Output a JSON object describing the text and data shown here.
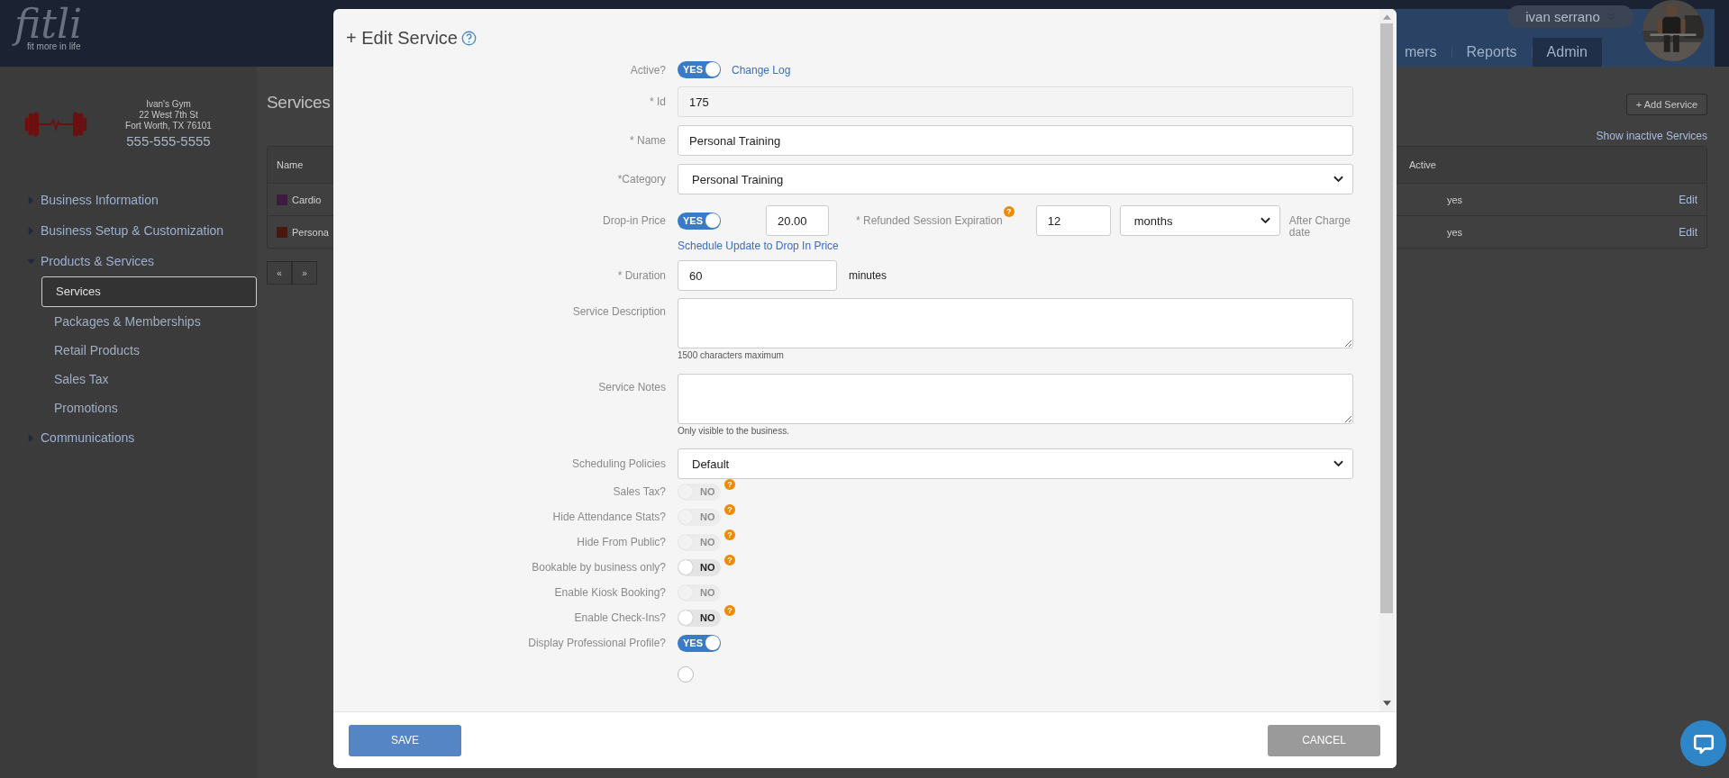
{
  "header": {
    "logo": "fitli",
    "tagline": "fit more in life",
    "user": "ivan serrano",
    "tabs": [
      {
        "label": "mers",
        "selected": false
      },
      {
        "label": "Reports",
        "selected": false
      },
      {
        "label": "Admin",
        "selected": true
      }
    ]
  },
  "sidebar": {
    "business": {
      "name": "Ivan's Gym",
      "lines": [
        "22 West 7th St",
        "Fort Worth, TX 76101"
      ],
      "phone": "555-555-5555"
    },
    "nav": [
      {
        "label": "Business Information",
        "expanded": false
      },
      {
        "label": "Business Setup & Customization",
        "expanded": false
      },
      {
        "label": "Products & Services",
        "expanded": true,
        "children": [
          {
            "label": "Services",
            "selected": true
          },
          {
            "label": "Packages & Memberships",
            "selected": false
          },
          {
            "label": "Retail Products",
            "selected": false
          },
          {
            "label": "Sales Tax",
            "selected": false
          },
          {
            "label": "Promotions",
            "selected": false
          }
        ]
      },
      {
        "label": "Communications",
        "expanded": false
      }
    ]
  },
  "main": {
    "title": "Services",
    "add_button": "+ Add Service",
    "inactive_link": "Show inactive Services",
    "table": {
      "columns": [
        "Name",
        "Active"
      ],
      "rows": [
        {
          "name": "Cardio",
          "color": "#3d1a3f",
          "active": "yes",
          "action": "Edit"
        },
        {
          "name": "Persona",
          "color": "#4a1610",
          "active": "yes",
          "action": "Edit"
        }
      ]
    },
    "pager": [
      "«",
      "»"
    ]
  },
  "modal": {
    "title": "+ Edit Service",
    "active": {
      "label": "Active?",
      "on": true,
      "toggle_text": "YES",
      "link": "Change Log"
    },
    "id": {
      "label": "* Id",
      "value": "175"
    },
    "name": {
      "label": "* Name",
      "value": "Personal Training"
    },
    "category": {
      "label": "*Category",
      "value": "Personal Training"
    },
    "drop_in": {
      "label": "Drop-in Price",
      "on": true,
      "toggle_text": "YES",
      "price": "20.00",
      "refund_label": "* Refunded Session Expiration",
      "refund_value": "12",
      "refund_unit": "months",
      "after": "After Charge date",
      "schedule_link": "Schedule Update to Drop In Price"
    },
    "duration": {
      "label": "* Duration",
      "value": "60",
      "unit": "minutes"
    },
    "description": {
      "label": "Service Description",
      "note": "1500 characters maximum"
    },
    "notes": {
      "label": "Service Notes",
      "note": "Only visible to the business."
    },
    "scheduling": {
      "label": "Scheduling Policies",
      "value": "Default"
    },
    "switches": [
      {
        "label": "Sales Tax?",
        "on": false,
        "toggle_text": "NO",
        "disabled": true,
        "help": true
      },
      {
        "label": "Hide Attendance Stats?",
        "on": false,
        "toggle_text": "NO",
        "disabled": true,
        "help": true
      },
      {
        "label": "Hide From Public?",
        "on": false,
        "toggle_text": "NO",
        "disabled": true,
        "help": true
      },
      {
        "label": "Bookable by business only?",
        "on": false,
        "toggle_text": "NO",
        "disabled": false,
        "help": true
      },
      {
        "label": "Enable Kiosk Booking?",
        "on": false,
        "toggle_text": "NO",
        "disabled": true,
        "help": false
      },
      {
        "label": "Enable Check-Ins?",
        "on": false,
        "toggle_text": "NO",
        "disabled": false,
        "help": true
      },
      {
        "label": "Display Professional Profile?",
        "on": true,
        "toggle_text": "YES",
        "disabled": false,
        "help": false
      }
    ],
    "radio": {
      "checked": false
    },
    "help_mark": "?",
    "save": "SAVE",
    "cancel": "CANCEL"
  }
}
